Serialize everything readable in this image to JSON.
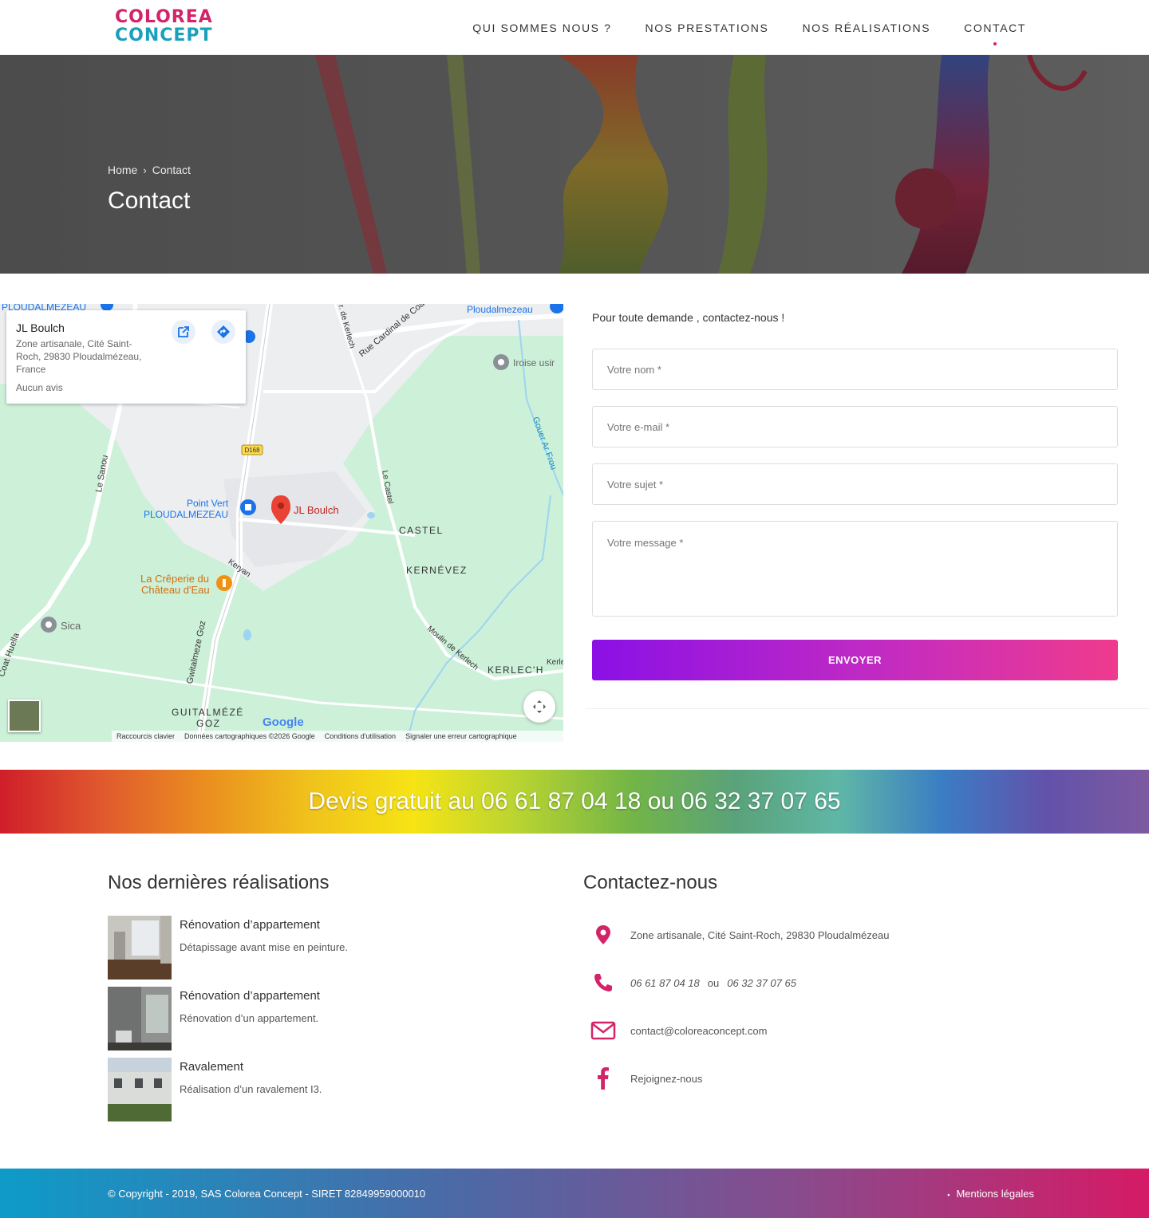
{
  "brand": {
    "line1": "COLOREA",
    "line2": "CONCEPT",
    "pink": "#d3246a",
    "blue": "#1a9fbd"
  },
  "nav": [
    {
      "label": "QUI SOMMES NOUS ?"
    },
    {
      "label": "NOS PRESTATIONS"
    },
    {
      "label": "NOS RÉALISATIONS"
    },
    {
      "label": "CONTACT",
      "active": true
    }
  ],
  "hero": {
    "breadcrumb": {
      "home": "Home",
      "separator": "›",
      "current": "Contact"
    },
    "title": "Contact"
  },
  "map": {
    "card": {
      "name": "JL Boulch",
      "address": "Zone artisanale, Cité Saint-Roch, 29830 Ploudalmézeau, France",
      "reviews": "Aucun avis"
    },
    "labels": {
      "ploudalmezeau_top": "PLOUDALMEZEAU",
      "ploudalmezeau_right": "Ploudalmezeau",
      "iroise": "Iroise usir",
      "rue_cardinal": "Rue Cardinal de Coativy",
      "de_kerlech": "r. de Kerlech",
      "gouer": "Gouer Ar Frou",
      "d168": "D168",
      "le_sanou": "Le Sanou",
      "le_castel": "Le Castel",
      "point_vert_1": "Point Vert",
      "point_vert_2": "PLOUDALMEZEAU",
      "marker": "JL Boulch",
      "castel": "CASTEL",
      "keryan": "Keryan",
      "creperie_1": "La Crêperie du",
      "creperie_2": "Château d'Eau",
      "kernevez": "KERNÉVEZ",
      "sica": "Sica",
      "coat_huella": "Coat Huella",
      "gwitalmeze": "Gwitalmeze Goz",
      "moulin": "Moulin de Kerlech",
      "kerlech_road": "Kerle",
      "kerlech": "KERLEC'H",
      "guitalmeze_1": "GUITALMÉZÉ",
      "guitalmeze_2": "GOZ"
    },
    "footer": {
      "shortcuts": "Raccourcis clavier",
      "data": "Données cartographiques ©2026 Google",
      "terms": "Conditions d'utilisation",
      "report": "Signaler une erreur cartographique"
    },
    "google": "Google"
  },
  "form": {
    "intro": "Pour toute demande , contactez-nous !",
    "name_placeholder": "Votre nom *",
    "email_placeholder": "Votre e-mail *",
    "subject_placeholder": "Votre sujet *",
    "message_placeholder": "Votre message *",
    "submit": "ENVOYER"
  },
  "banner": {
    "text": "Devis gratuit au 06 61 87 04 18 ou 06 32 37 07 65",
    "colors": [
      "#cf1e2a",
      "#e05a2e",
      "#ea8f1f",
      "#f0c21c",
      "#f6e414",
      "#b9d431",
      "#73b547",
      "#5aa27a",
      "#5fb7a6",
      "#3a7dc4",
      "#6252aa",
      "#7d5aa0"
    ]
  },
  "realisations": {
    "title": "Nos dernières réalisations",
    "items": [
      {
        "title": "Rénovation d’appartement",
        "desc": "Détapissage avant mise en peinture."
      },
      {
        "title": "Rénovation d’appartement",
        "desc": "Rénovation d’un appartement."
      },
      {
        "title": "Ravalement",
        "desc": "Réalisation d’un ravalement I3."
      }
    ]
  },
  "contact": {
    "title": "Contactez-nous",
    "address": "Zone artisanale, Cité Saint-Roch, 29830 Ploudalmézeau",
    "phone1": "06 61 87 04 18",
    "phone_or": "ou",
    "phone2": "06 32 37 07 65",
    "email": "contact@coloreaconcept.com",
    "social": "Rejoignez-nous",
    "icon_color": "#d3246a"
  },
  "footer": {
    "copyright": "© Copyright - 2019, SAS Colorea Concept - SIRET 82849959000010",
    "legal": "Mentions légales"
  }
}
